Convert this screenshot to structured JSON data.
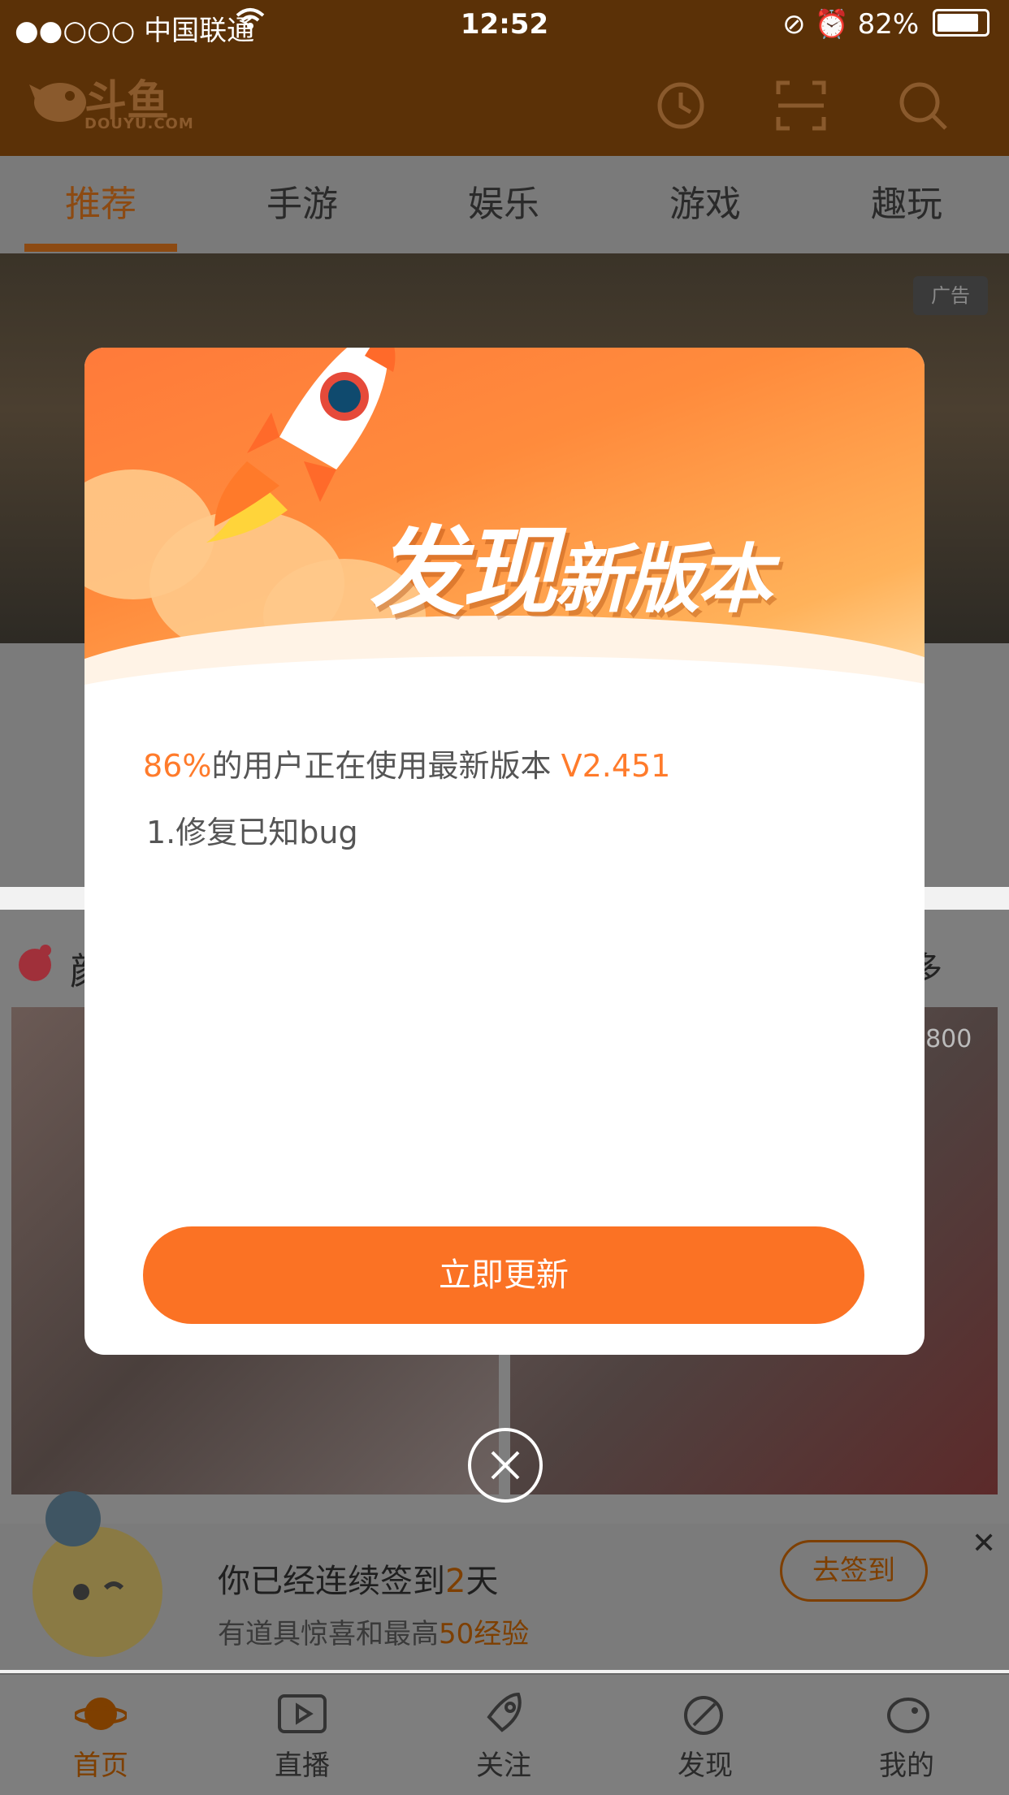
{
  "status_bar": {
    "carrier": "●●○○○ 中国联通",
    "time": "12:52",
    "battery": "82%"
  },
  "header": {
    "logo_text": "斗鱼",
    "logo_sub": "DOUYU.COM",
    "icons": [
      "history-icon",
      "scan-icon",
      "search-icon"
    ]
  },
  "tabs": [
    {
      "label": "推荐"
    },
    {
      "label": "手游"
    },
    {
      "label": "娱乐"
    },
    {
      "label": "游戏"
    },
    {
      "label": "趣玩"
    }
  ],
  "banner": {
    "ad_label": "广告"
  },
  "section": {
    "title": "颜",
    "more": "多",
    "count": "5800"
  },
  "signin": {
    "title_prefix": "你已经连续签到",
    "days": "2",
    "title_suffix": "天",
    "sub_prefix": "有道具惊喜和最高",
    "exp": "50经验",
    "button": "去签到"
  },
  "bottom_nav": [
    {
      "label": "首页",
      "icon": "planet-icon"
    },
    {
      "label": "直播",
      "icon": "play-icon"
    },
    {
      "label": "关注",
      "icon": "rocket-icon"
    },
    {
      "label": "发现",
      "icon": "satellite-icon"
    },
    {
      "label": "我的",
      "icon": "fish-icon"
    }
  ],
  "dialog": {
    "title_main": "发现",
    "title_rest": "新版本",
    "percent": "86%",
    "text_middle": "的用户正在使用最新版本",
    "version": "V2.451",
    "note": "1.修复已知bug",
    "button": "立即更新"
  },
  "colors": {
    "accent": "#fb7224",
    "header_bg": "#5b3107"
  }
}
